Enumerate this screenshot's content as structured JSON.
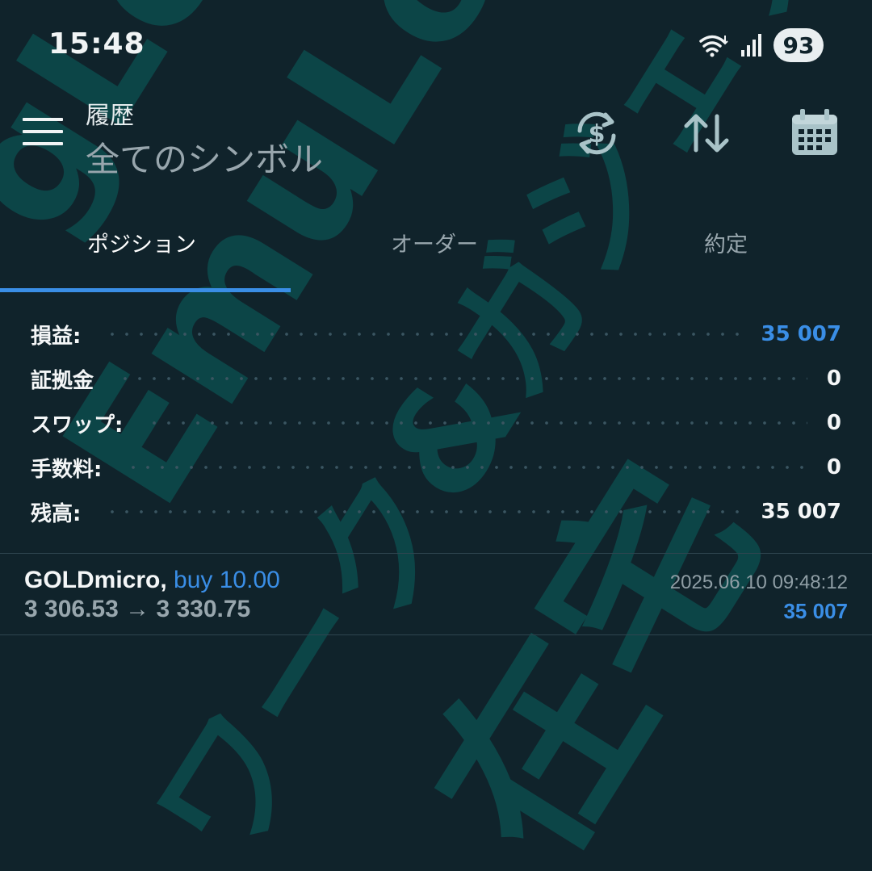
{
  "status_bar": {
    "time": "15:48",
    "battery": "93"
  },
  "header": {
    "title": "履歴",
    "subtitle": "全てのシンボル"
  },
  "toolbar": {
    "icons": [
      "dollar-refresh-icon",
      "sort-icon",
      "calendar-icon"
    ]
  },
  "tabs": [
    {
      "label": "ポジション",
      "active": true
    },
    {
      "label": "オーダー",
      "active": false
    },
    {
      "label": "約定",
      "active": false
    }
  ],
  "summary": [
    {
      "label": "損益:",
      "value": "35 007"
    },
    {
      "label": "証拠金",
      "value": "0"
    },
    {
      "label": "スワップ:",
      "value": "0"
    },
    {
      "label": "手数料:",
      "value": "0"
    },
    {
      "label": "残高:",
      "value": "35 007"
    }
  ],
  "deal": {
    "symbol": "GOLDmicro,",
    "side": "buy 10.00",
    "prices": "3 306.53 → 3 330.75",
    "time": "2025.06.10 09:48:12",
    "profit": "35 007"
  },
  "watermark": {
    "lines": [
      "gLog",
      "EmuLog@",
      "ワーク&ガジェット",
      "在宅"
    ]
  },
  "colors": {
    "background": "#10232b",
    "accent": "#3a8ee6",
    "watermark": "#0c4547",
    "muted": "#98a6ad"
  }
}
